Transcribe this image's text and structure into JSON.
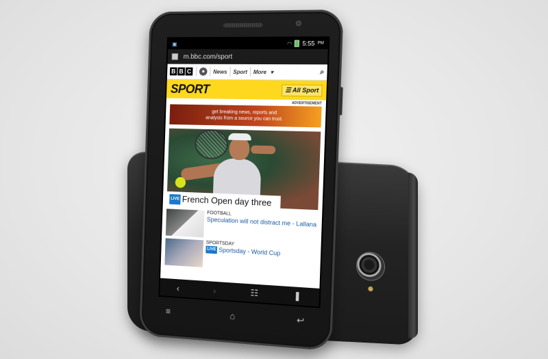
{
  "status_bar": {
    "time": "5:55",
    "time_suffix": "PM"
  },
  "browser": {
    "url": "m.bbc.com/sport"
  },
  "bbc_nav": {
    "logo_letters": [
      "B",
      "B",
      "C"
    ],
    "news_label": "News",
    "sport_label": "Sport",
    "more_label": "More",
    "more_arrow": "▾",
    "search_symbol": "⌕"
  },
  "sport_header": {
    "title": "SPORT",
    "menu_symbol": "☰",
    "all_sport_label": "All Sport"
  },
  "advert": {
    "label": "ADVERTISEMENT",
    "line1": "get breaking news, reports and",
    "line2": "analysis from a source you can trust."
  },
  "headline": {
    "badge": "LIVE",
    "text": "French Open day three"
  },
  "stories": [
    {
      "category": "FOOTBALL",
      "badge": "",
      "title": "Speculation will not distract me - Lallana"
    },
    {
      "category": "SPORTSDAY",
      "badge": "LIVE",
      "title": "Sportsday - World Cup"
    }
  ],
  "browser_nav": {
    "back": "‹",
    "forward": "›",
    "tabs": "☷",
    "bookmark": "❚"
  },
  "hw_keys": {
    "menu": "≡",
    "home": "⌂",
    "back": "↩"
  }
}
